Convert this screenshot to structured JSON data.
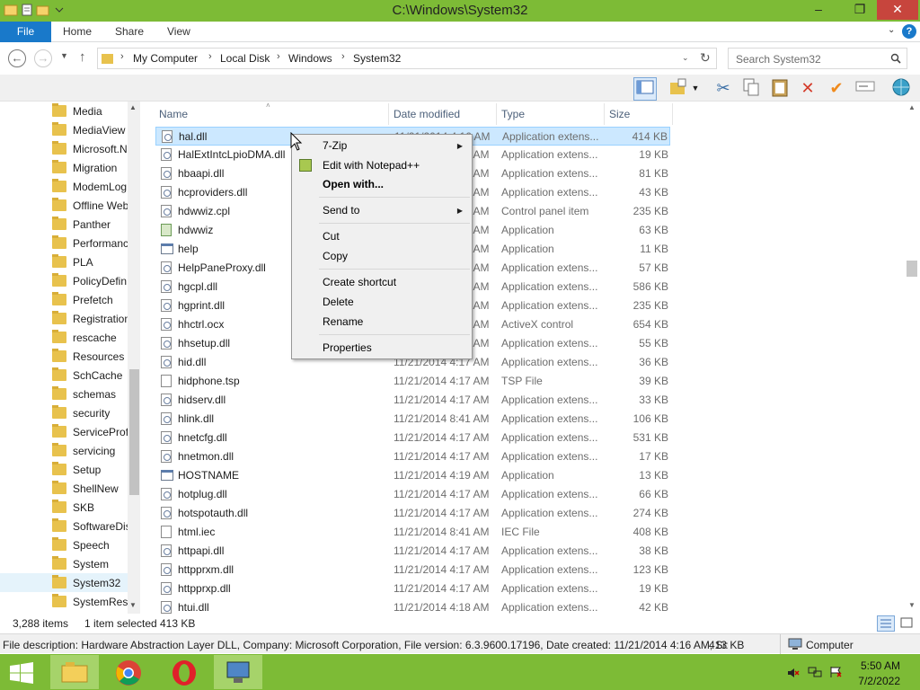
{
  "window": {
    "title": "C:\\Windows\\System32",
    "minimize": "–",
    "restore": "❐",
    "close": "✕"
  },
  "ribbon": {
    "file": "File",
    "tabs": [
      "Home",
      "Share",
      "View"
    ],
    "help": "?"
  },
  "address": {
    "crumbs": [
      "My Computer",
      "Local Disk",
      "Windows",
      "System32"
    ],
    "search_placeholder": "Search System32"
  },
  "navpane": {
    "items": [
      "Media",
      "MediaView",
      "Microsoft.N",
      "Migration",
      "ModemLog",
      "Offline Web",
      "Panther",
      "Performanc",
      "PLA",
      "PolicyDefin",
      "Prefetch",
      "Registration",
      "rescache",
      "Resources",
      "SchCache",
      "schemas",
      "security",
      "ServiceProf",
      "servicing",
      "Setup",
      "ShellNew",
      "SKB",
      "SoftwareDis",
      "Speech",
      "System",
      "System32",
      "SystemReso"
    ],
    "selected": "System32"
  },
  "columns": {
    "name": "Name",
    "date": "Date modified",
    "type": "Type",
    "size": "Size"
  },
  "files": [
    {
      "name": "hal.dll",
      "date": "11/21/2014 4:16 AM",
      "type": "Application extens...",
      "size": "414 KB",
      "icon": "dll"
    },
    {
      "name": "HalExtIntcLpioDMA.dll",
      "date": "11/21/2014 4:16 AM",
      "type": "Application extens...",
      "size": "19 KB",
      "icon": "dll"
    },
    {
      "name": "hbaapi.dll",
      "date": "11/21/2014 4:17 AM",
      "type": "Application extens...",
      "size": "81 KB",
      "icon": "dll"
    },
    {
      "name": "hcproviders.dll",
      "date": "11/21/2014 4:17 AM",
      "type": "Application extens...",
      "size": "43 KB",
      "icon": "dll"
    },
    {
      "name": "hdwwiz.cpl",
      "date": "11/21/2014 4:17 AM",
      "type": "Control panel item",
      "size": "235 KB",
      "icon": "dll"
    },
    {
      "name": "hdwwiz",
      "date": "11/21/2014 4:17 AM",
      "type": "Application",
      "size": "63 KB",
      "icon": "setup"
    },
    {
      "name": "help",
      "date": "11/21/2014 4:17 AM",
      "type": "Application",
      "size": "11 KB",
      "icon": "app"
    },
    {
      "name": "HelpPaneProxy.dll",
      "date": "11/21/2014 4:17 AM",
      "type": "Application extens...",
      "size": "57 KB",
      "icon": "dll"
    },
    {
      "name": "hgcpl.dll",
      "date": "11/21/2014 4:17 AM",
      "type": "Application extens...",
      "size": "586 KB",
      "icon": "dll"
    },
    {
      "name": "hgprint.dll",
      "date": "11/21/2014 4:17 AM",
      "type": "Application extens...",
      "size": "235 KB",
      "icon": "dll"
    },
    {
      "name": "hhctrl.ocx",
      "date": "11/21/2014 4:17 AM",
      "type": "ActiveX control",
      "size": "654 KB",
      "icon": "dll"
    },
    {
      "name": "hhsetup.dll",
      "date": "11/21/2014 4:17 AM",
      "type": "Application extens...",
      "size": "55 KB",
      "icon": "dll"
    },
    {
      "name": "hid.dll",
      "date": "11/21/2014 4:17 AM",
      "type": "Application extens...",
      "size": "36 KB",
      "icon": "dll"
    },
    {
      "name": "hidphone.tsp",
      "date": "11/21/2014 4:17 AM",
      "type": "TSP File",
      "size": "39 KB",
      "icon": "blank"
    },
    {
      "name": "hidserv.dll",
      "date": "11/21/2014 4:17 AM",
      "type": "Application extens...",
      "size": "33 KB",
      "icon": "dll"
    },
    {
      "name": "hlink.dll",
      "date": "11/21/2014 8:41 AM",
      "type": "Application extens...",
      "size": "106 KB",
      "icon": "dll"
    },
    {
      "name": "hnetcfg.dll",
      "date": "11/21/2014 4:17 AM",
      "type": "Application extens...",
      "size": "531 KB",
      "icon": "dll"
    },
    {
      "name": "hnetmon.dll",
      "date": "11/21/2014 4:17 AM",
      "type": "Application extens...",
      "size": "17 KB",
      "icon": "dll"
    },
    {
      "name": "HOSTNAME",
      "date": "11/21/2014 4:19 AM",
      "type": "Application",
      "size": "13 KB",
      "icon": "app"
    },
    {
      "name": "hotplug.dll",
      "date": "11/21/2014 4:17 AM",
      "type": "Application extens...",
      "size": "66 KB",
      "icon": "dll"
    },
    {
      "name": "hotspotauth.dll",
      "date": "11/21/2014 4:17 AM",
      "type": "Application extens...",
      "size": "274 KB",
      "icon": "dll"
    },
    {
      "name": "html.iec",
      "date": "11/21/2014 8:41 AM",
      "type": "IEC File",
      "size": "408 KB",
      "icon": "blank"
    },
    {
      "name": "httpapi.dll",
      "date": "11/21/2014 4:17 AM",
      "type": "Application extens...",
      "size": "38 KB",
      "icon": "dll"
    },
    {
      "name": "httpprxm.dll",
      "date": "11/21/2014 4:17 AM",
      "type": "Application extens...",
      "size": "123 KB",
      "icon": "dll"
    },
    {
      "name": "httpprxp.dll",
      "date": "11/21/2014 4:17 AM",
      "type": "Application extens...",
      "size": "19 KB",
      "icon": "dll"
    },
    {
      "name": "htui.dll",
      "date": "11/21/2014 4:18 AM",
      "type": "Application extens...",
      "size": "42 KB",
      "icon": "dll"
    }
  ],
  "context_menu": {
    "zip": "7-Zip",
    "notepad": "Edit with Notepad++",
    "open_with": "Open with...",
    "send_to": "Send to",
    "cut": "Cut",
    "copy": "Copy",
    "create_shortcut": "Create shortcut",
    "delete": "Delete",
    "rename": "Rename",
    "properties": "Properties"
  },
  "status": {
    "count": "3,288 items",
    "selected": "1 item selected",
    "size": "413 KB"
  },
  "details": {
    "text": "File description: Hardware Abstraction Layer DLL, Company: Microsoft Corporation, File version: 6.3.9600.17196, Date created: 11/21/2014 4:16 AM, Si:",
    "size": "413 KB",
    "computer": "Computer"
  },
  "taskbar": {
    "time": "5:50 AM",
    "date": "7/2/2022"
  },
  "colors": {
    "accent": "#7dbb36",
    "file_tab": "#1979ca",
    "selection": "#cce8ff"
  }
}
